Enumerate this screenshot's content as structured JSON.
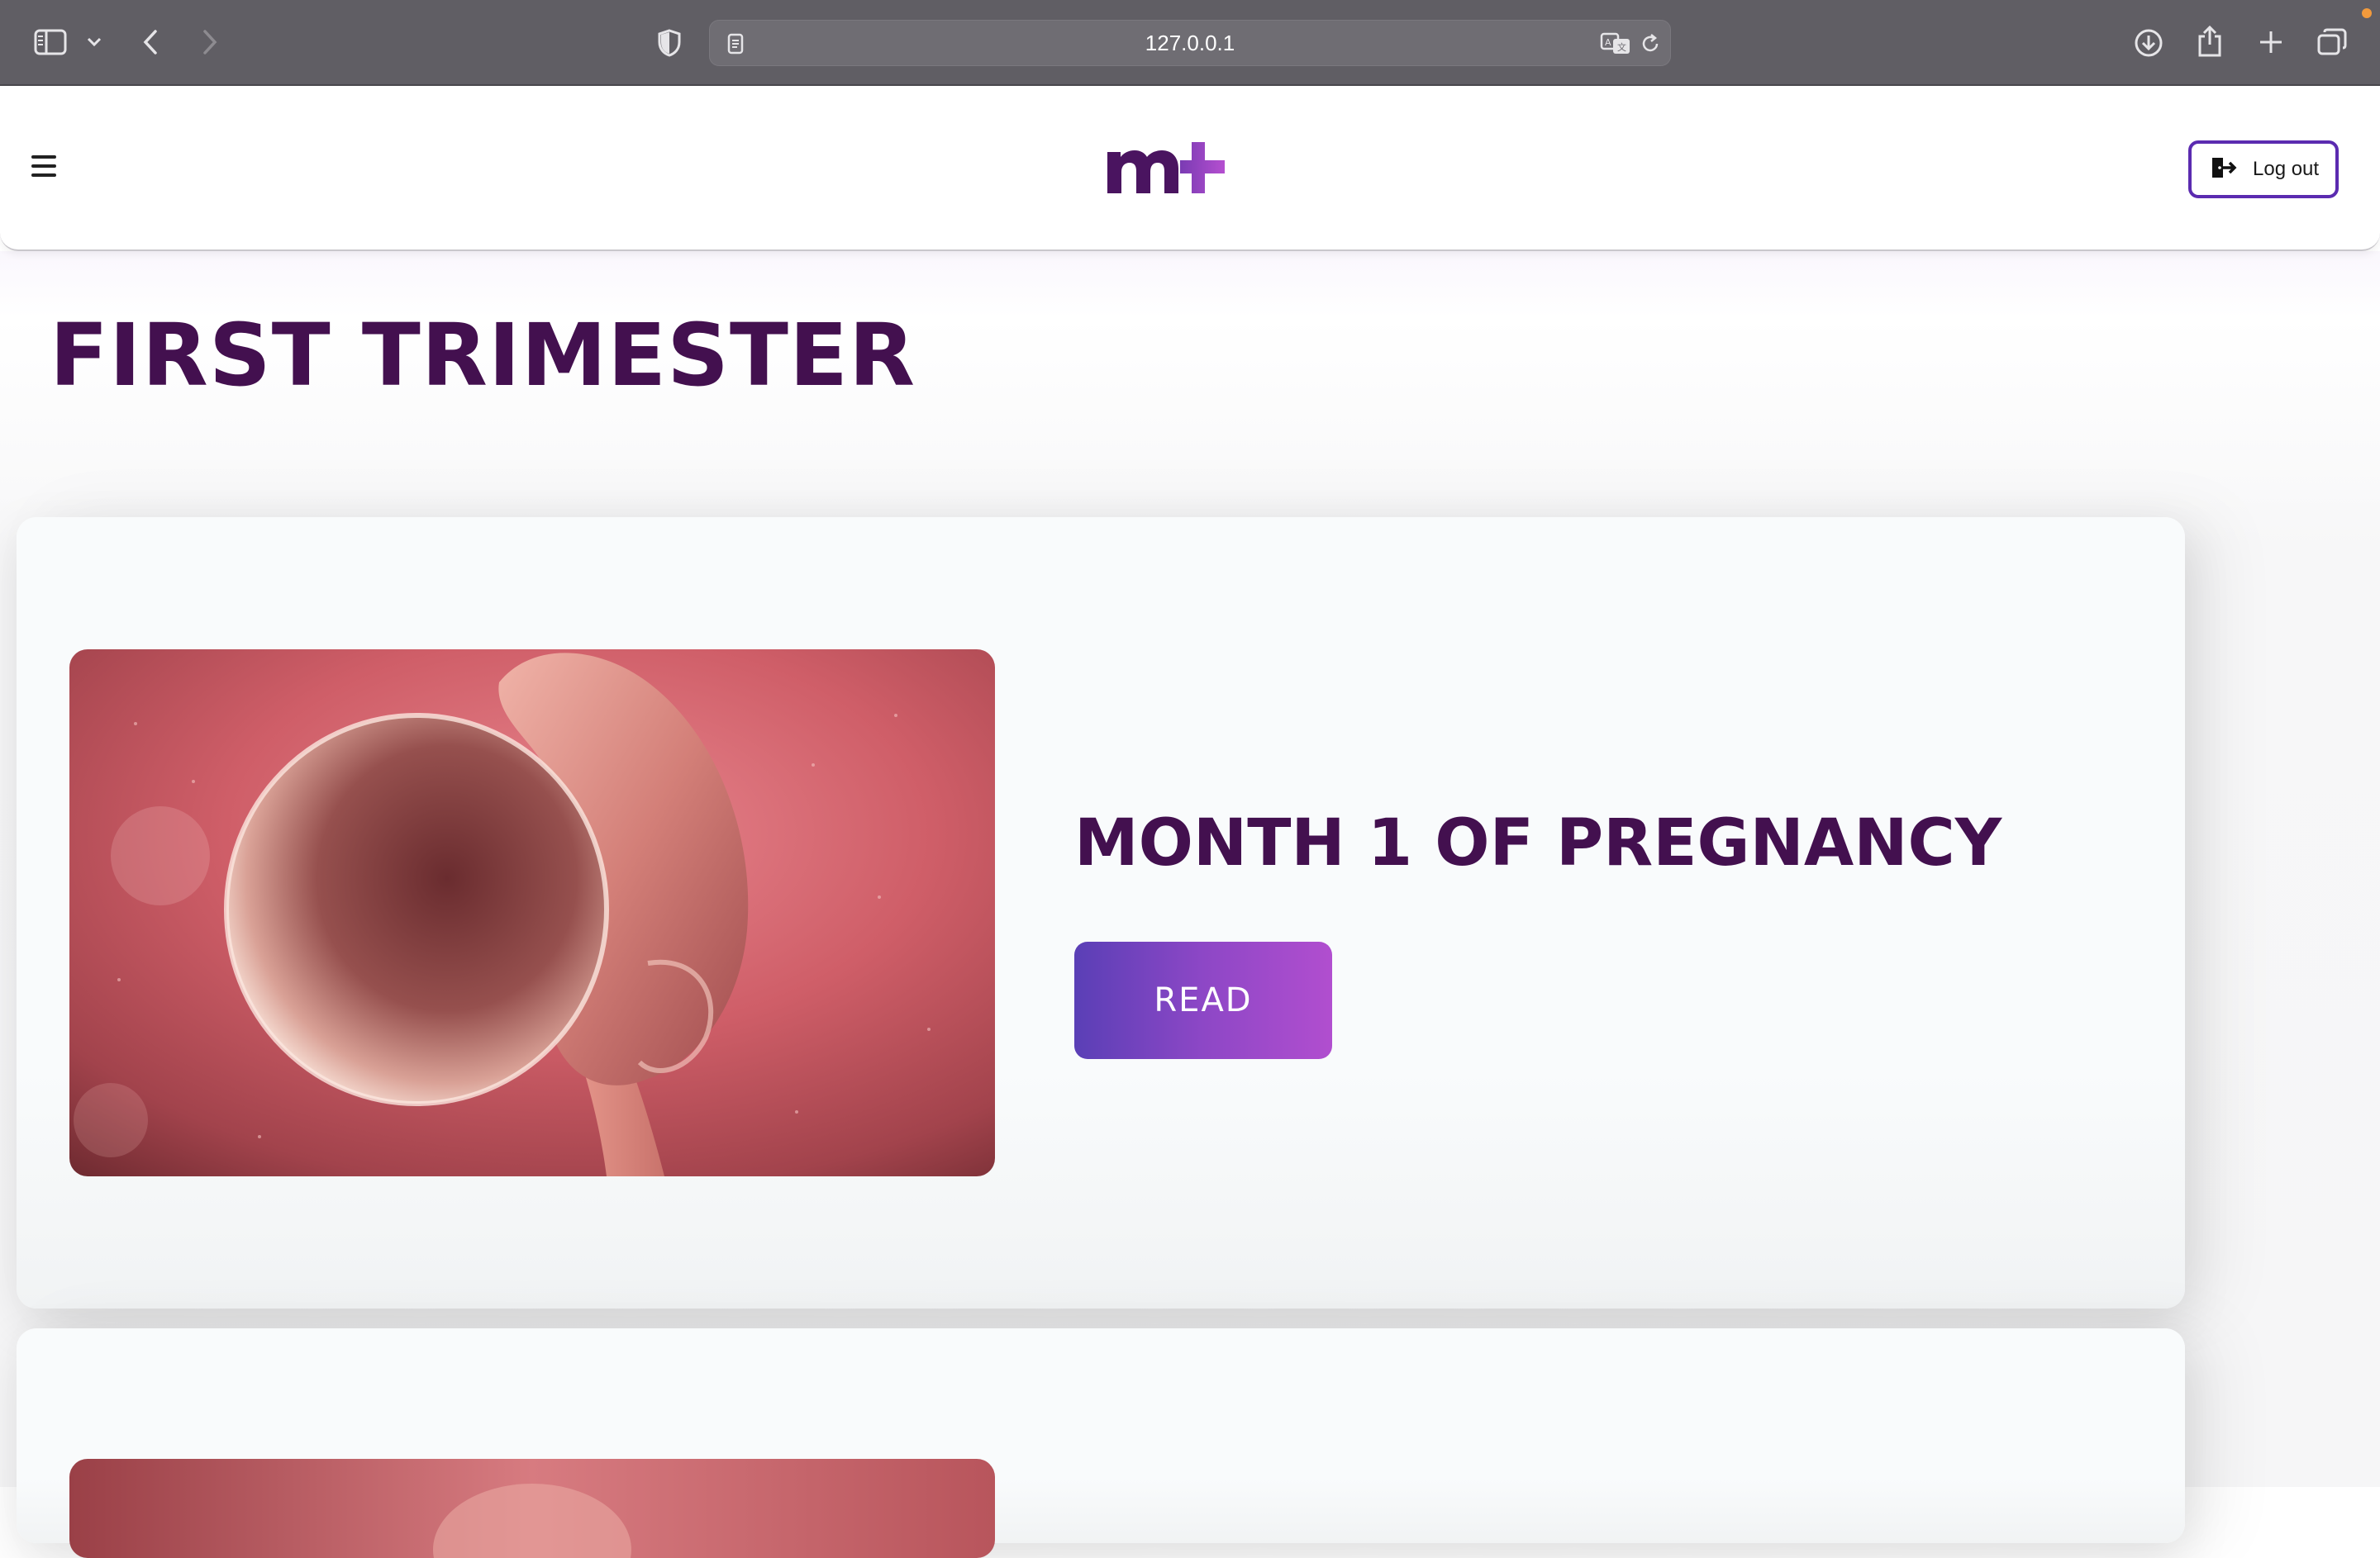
{
  "browser": {
    "url": "127.0.0.1",
    "icons": {
      "sidebar": "sidebar-toggle-icon",
      "tab_overview_menu": "chevron-down-icon",
      "back": "back-arrow-icon",
      "forward": "forward-arrow-icon",
      "privacy": "shield-icon",
      "reader": "reader-mode-icon",
      "translate": "translate-icon",
      "reload": "reload-icon",
      "downloads": "download-icon",
      "share": "share-icon",
      "new_tab": "plus-icon",
      "tabs": "tab-overview-icon"
    }
  },
  "header": {
    "menu_icon": "hamburger-menu-icon",
    "logo_text": "m+",
    "logout_label": "Log out",
    "logout_icon": "logout-icon"
  },
  "main": {
    "title": "FIRST TRIMESTER",
    "cards": [
      {
        "heading": "MONTH 1 OF PREGNANCY",
        "button_label": "READ",
        "image": "fetus-illustration"
      },
      {
        "image": "fetus-illustration"
      }
    ]
  },
  "colors": {
    "brand_purple_dark": "#43104f",
    "brand_purple": "#5b2bb0",
    "gradient_start": "#5a3fb6",
    "gradient_end": "#b14ecf",
    "browser_toolbar": "#605e64"
  }
}
